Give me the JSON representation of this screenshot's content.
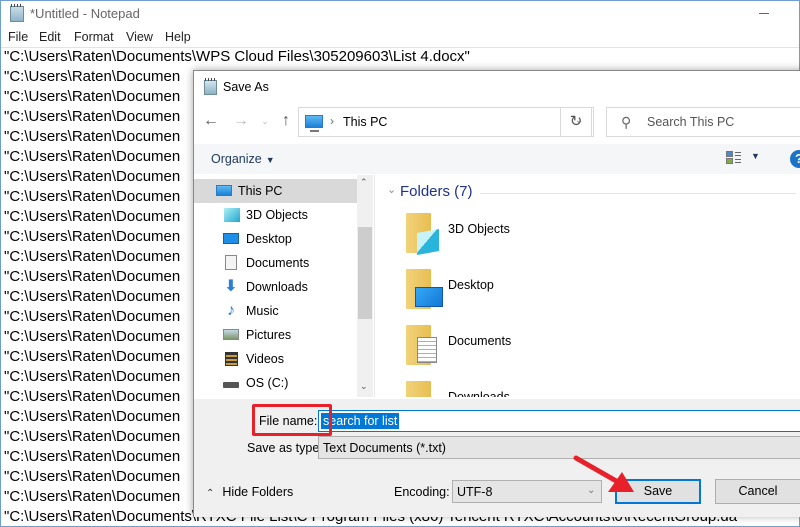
{
  "notepad": {
    "title": "*Untitled - Notepad",
    "menu": [
      "File",
      "Edit",
      "Format",
      "View",
      "Help"
    ],
    "lines": [
      "\"C:\\Users\\Raten\\Documents\\WPS Cloud Files\\305209603\\List 4.docx\"",
      "\"C:\\Users\\Raten\\Documen",
      "\"C:\\Users\\Raten\\Documen",
      "\"C:\\Users\\Raten\\Documen",
      "\"C:\\Users\\Raten\\Documen",
      "\"C:\\Users\\Raten\\Documen",
      "\"C:\\Users\\Raten\\Documen",
      "\"C:\\Users\\Raten\\Documen",
      "\"C:\\Users\\Raten\\Documen",
      "\"C:\\Users\\Raten\\Documen",
      "\"C:\\Users\\Raten\\Documen",
      "\"C:\\Users\\Raten\\Documen",
      "\"C:\\Users\\Raten\\Documen",
      "\"C:\\Users\\Raten\\Documen",
      "\"C:\\Users\\Raten\\Documen",
      "\"C:\\Users\\Raten\\Documen",
      "\"C:\\Users\\Raten\\Documen",
      "\"C:\\Users\\Raten\\Documen",
      "\"C:\\Users\\Raten\\Documen",
      "\"C:\\Users\\Raten\\Documen",
      "\"C:\\Users\\Raten\\Documen",
      "\"C:\\Users\\Raten\\Documen",
      "\"C:\\Users\\Raten\\Documen",
      "\"C:\\Users\\Raten\\Documents\\RTXC File List\\C Program Files (x86) Tencent RTXC\\Accounts\\0\\RecentGroup.da"
    ]
  },
  "dialog": {
    "title": "Save As",
    "address": {
      "location": "This PC"
    },
    "search": {
      "placeholder": "Search This PC"
    },
    "toolbar": {
      "organize": "Organize"
    },
    "nav_tree": [
      {
        "label": "This PC",
        "icon": "computer-icon",
        "selected": true
      },
      {
        "label": "3D Objects",
        "icon": "3d-objects-icon"
      },
      {
        "label": "Desktop",
        "icon": "desktop-icon"
      },
      {
        "label": "Documents",
        "icon": "documents-icon"
      },
      {
        "label": "Downloads",
        "icon": "downloads-icon"
      },
      {
        "label": "Music",
        "icon": "music-icon"
      },
      {
        "label": "Pictures",
        "icon": "pictures-icon"
      },
      {
        "label": "Videos",
        "icon": "videos-icon"
      },
      {
        "label": "OS (C:)",
        "icon": "drive-icon"
      }
    ],
    "content": {
      "group_title": "Folders (7)",
      "folders": [
        "3D Objects",
        "Desktop",
        "Documents",
        "Downloads"
      ]
    },
    "file_name": {
      "label": "File name:",
      "value": "search for list"
    },
    "save_as_type": {
      "label": "Save as type:",
      "value": "Text Documents (*.txt)"
    },
    "hide_folders": "Hide Folders",
    "encoding": {
      "label": "Encoding:",
      "value": "UTF-8"
    },
    "buttons": {
      "save": "Save",
      "cancel": "Cancel"
    }
  },
  "colors": {
    "accent": "#0078d7",
    "annotation_red": "#e8202a",
    "folder_yellow": "#f2d27a",
    "group_title": "#1e3287"
  }
}
